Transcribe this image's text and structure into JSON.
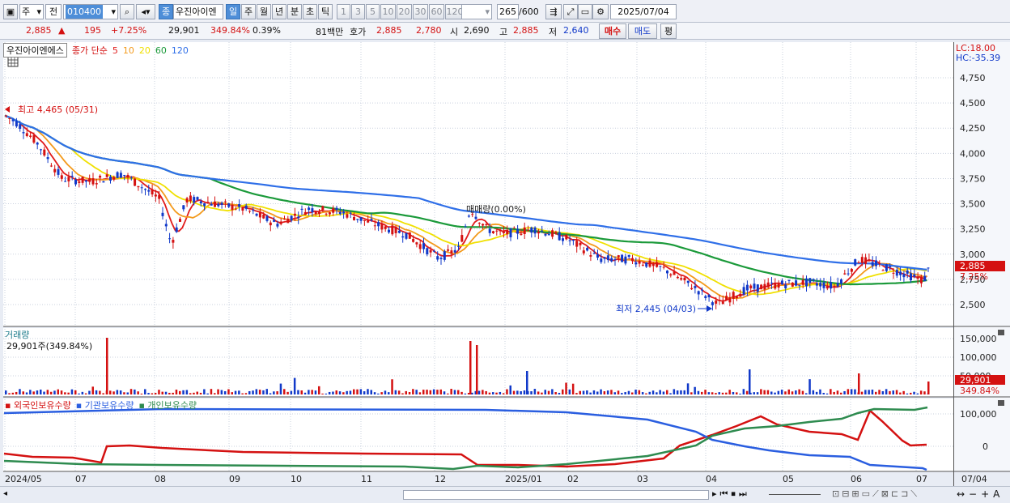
{
  "toolbar": {
    "period_select": "주",
    "market_select": "전",
    "stock_code": "010400",
    "stock_name": "우진아이엔",
    "timeframes": [
      "일",
      "주",
      "월",
      "년",
      "분",
      "초",
      "틱"
    ],
    "active_timeframe": "일",
    "minute_steps": [
      "1",
      "3",
      "5",
      "10",
      "20",
      "30",
      "60",
      "120"
    ],
    "count_current": "265",
    "count_total": "/600",
    "date": "2025/07/04",
    "jong_label": "종"
  },
  "quote": {
    "price": "2,885",
    "change": "195",
    "change_pct": "+7.25%",
    "volume": "29,901",
    "volume_ratio": "349.84%",
    "turnover": "0.39%",
    "amount": "81백만",
    "hoga_label": "호가",
    "ask": "2,885",
    "bid": "2,780",
    "open_label": "시",
    "open": "2,690",
    "high_label": "고",
    "high": "2,885",
    "low_label": "저",
    "low": "2,640",
    "buy_button": "매수",
    "sell_button": "매도",
    "eval_button": "평"
  },
  "legend": {
    "stock_name": "우진아이엔에스",
    "ma_label": "종가 단순",
    "ma_periods": [
      "5",
      "10",
      "20",
      "60",
      "120"
    ],
    "ma_colors": [
      "#e11b1b",
      "#f39a1c",
      "#f0e000",
      "#1b9a3a",
      "#2f6fe8"
    ]
  },
  "price_axis": {
    "ticks": [
      "4,750",
      "4,500",
      "4,250",
      "4,000",
      "3,750",
      "3,500",
      "3,250",
      "3,000",
      "2,750",
      "2,500"
    ],
    "lc": "LC:18.00",
    "hc": "HC:-35.39",
    "current_badge": "2,885",
    "current_pct": "7.25%"
  },
  "annotations": {
    "high": "최고 4,465 (05/31)",
    "low": "최저 2,445 (04/03)",
    "mid": "매매량(0.00%)"
  },
  "volume_panel": {
    "title": "거래량",
    "value": "29,901주(349.84%)",
    "ticks": [
      "150,000",
      "100,000",
      "50,000"
    ],
    "badge": "29,901",
    "badge_pct": "349.84%"
  },
  "ownership_panel": {
    "series": [
      "외국인보유수량",
      "기관보유수량",
      "개인보유수량"
    ],
    "series_colors": [
      "#d41111",
      "#2a5ee0",
      "#2e8b4f"
    ],
    "ticks": [
      "100,000",
      "0"
    ]
  },
  "x_axis": {
    "labels": [
      "2024/05",
      "07",
      "08",
      "09",
      "10",
      "11",
      "12",
      "2025/01",
      "02",
      "03",
      "04",
      "05",
      "06",
      "07"
    ],
    "right_label": "07/04"
  },
  "colors": {
    "up": "#d41111",
    "down": "#1139c9",
    "panel_bg": "#ffffff",
    "axis_bg": "#f5f7fb"
  }
}
